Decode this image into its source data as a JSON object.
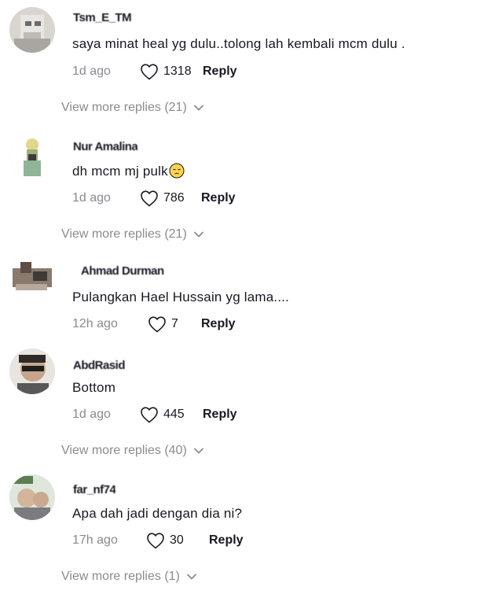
{
  "comments": [
    {
      "username": "Tsm_E_TM",
      "text": "saya minat heal yg dulu..tolong lah kembali mcm dulu .",
      "time": "1d ago",
      "likes": "1318",
      "reply_label": "Reply",
      "view_more": "View more replies (21)"
    },
    {
      "username": "Nur Amalina",
      "text": "dh mcm mj pulk",
      "emoji": "pensive-face-emoji",
      "time": "1d ago",
      "likes": "786",
      "reply_label": "Reply",
      "view_more": "View more replies (21)"
    },
    {
      "username": "Ahmad Durman",
      "text": "Pulangkan Hael Hussain yg lama....",
      "time": "12h ago",
      "likes": "7",
      "reply_label": "Reply"
    },
    {
      "username": "AbdRasid",
      "text": "Bottom",
      "time": "1d ago",
      "likes": "445",
      "reply_label": "Reply",
      "view_more": "View more replies (40)"
    },
    {
      "username": "far_nf74",
      "text": "Apa dah jadi dengan dia ni?",
      "time": "17h ago",
      "likes": "30",
      "reply_label": "Reply",
      "view_more": "View more replies (1)"
    }
  ],
  "icons": {
    "like": "heart-outline-icon",
    "expand": "chevron-down-icon"
  },
  "colors": {
    "text": "#161823",
    "muted": "#8a8b91"
  }
}
